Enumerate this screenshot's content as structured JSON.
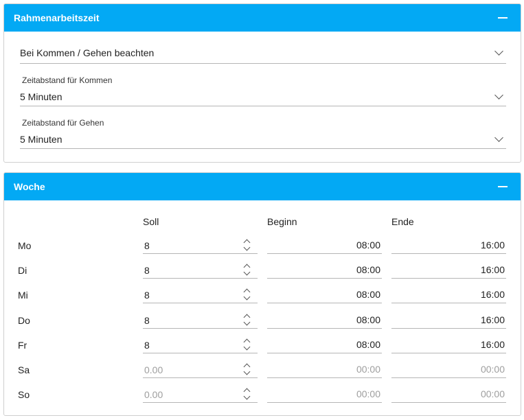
{
  "rahmen": {
    "title": "Rahmenarbeitszeit",
    "mode_value": "Bei Kommen / Gehen beachten",
    "kommen_label": "Zeitabstand für Kommen",
    "kommen_value": "5 Minuten",
    "gehen_label": "Zeitabstand für Gehen",
    "gehen_value": "5 Minuten"
  },
  "woche": {
    "title": "Woche",
    "headers": {
      "soll": "Soll",
      "beginn": "Beginn",
      "ende": "Ende"
    },
    "rows": [
      {
        "day": "Mo",
        "soll": "8",
        "beginn": "08:00",
        "ende": "16:00"
      },
      {
        "day": "Di",
        "soll": "8",
        "beginn": "08:00",
        "ende": "16:00"
      },
      {
        "day": "Mi",
        "soll": "8",
        "beginn": "08:00",
        "ende": "16:00"
      },
      {
        "day": "Do",
        "soll": "8",
        "beginn": "08:00",
        "ende": "16:00"
      },
      {
        "day": "Fr",
        "soll": "8",
        "beginn": "08:00",
        "ende": "16:00"
      },
      {
        "day": "Sa",
        "soll_placeholder": "0.00",
        "beginn_placeholder": "00:00",
        "ende_placeholder": "00:00"
      },
      {
        "day": "So",
        "soll_placeholder": "0.00",
        "beginn_placeholder": "00:00",
        "ende_placeholder": "00:00"
      }
    ]
  },
  "colors": {
    "header": "#03a9f4",
    "placeholder": "#9e9e9e"
  }
}
